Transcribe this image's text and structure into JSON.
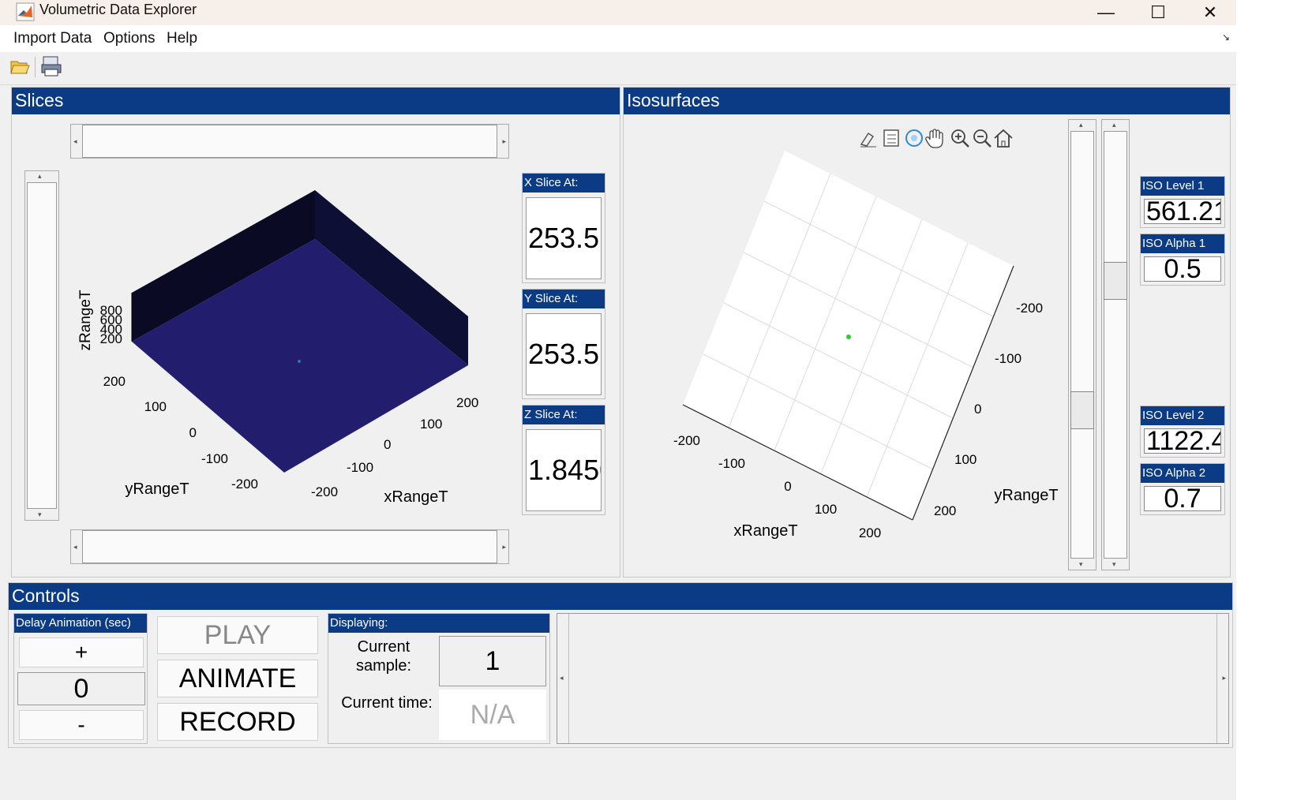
{
  "window": {
    "title": "Volumetric Data Explorer",
    "minimize": "—",
    "maximize": "☐",
    "close": "✕"
  },
  "menu": {
    "items": [
      "Import Data",
      "Options",
      "Help"
    ]
  },
  "slices": {
    "title": "Slices",
    "x_label": "X Slice At:",
    "x_value": "253.5",
    "y_label": "Y Slice At:",
    "y_value": "253.5",
    "z_label": "Z Slice At:",
    "z_value": "1.8450",
    "axis": {
      "x_title": "xRangeT",
      "y_title": "yRangeT",
      "z_title": "zRangeT",
      "x_ticks": [
        "-200",
        "-100",
        "0",
        "100",
        "200"
      ],
      "y_ticks": [
        "-200",
        "-100",
        "0",
        "100",
        "200"
      ],
      "z_ticks": [
        "200",
        "400",
        "600",
        "800"
      ]
    },
    "colors": {
      "top": "#231d6e",
      "side_dark": "#0a0a24",
      "side_mid": "#0d1034"
    }
  },
  "iso": {
    "title": "Isosurfaces",
    "level1_label": "ISO Level 1",
    "level1_value": "561.21",
    "alpha1_label": "ISO Alpha 1",
    "alpha1_value": "0.5",
    "level2_label": "ISO Level 2",
    "level2_value": "1122.4",
    "alpha2_label": "ISO Alpha 2",
    "alpha2_value": "0.7",
    "axis": {
      "x_title": "xRangeT",
      "y_title": "yRangeT",
      "x_ticks": [
        "-200",
        "-100",
        "0",
        "100",
        "200"
      ],
      "y_ticks": [
        "-200",
        "-100",
        "0",
        "100",
        "200"
      ]
    },
    "tools": [
      "edit-plot-icon",
      "legend-icon",
      "rotate-3d-icon",
      "pan-icon",
      "zoom-in-icon",
      "zoom-out-icon",
      "home-icon"
    ]
  },
  "controls": {
    "title": "Controls",
    "delay_label": "Delay Animation (sec)",
    "plus": "+",
    "delay_value": "0",
    "minus": "-",
    "play": "PLAY",
    "animate": "ANIMATE",
    "record": "RECORD",
    "displaying_label": "Displaying:",
    "current_sample_label": "Current\nsample:",
    "current_sample_value": "1",
    "current_time_label": "Current time:",
    "current_time_value": "N/A"
  }
}
